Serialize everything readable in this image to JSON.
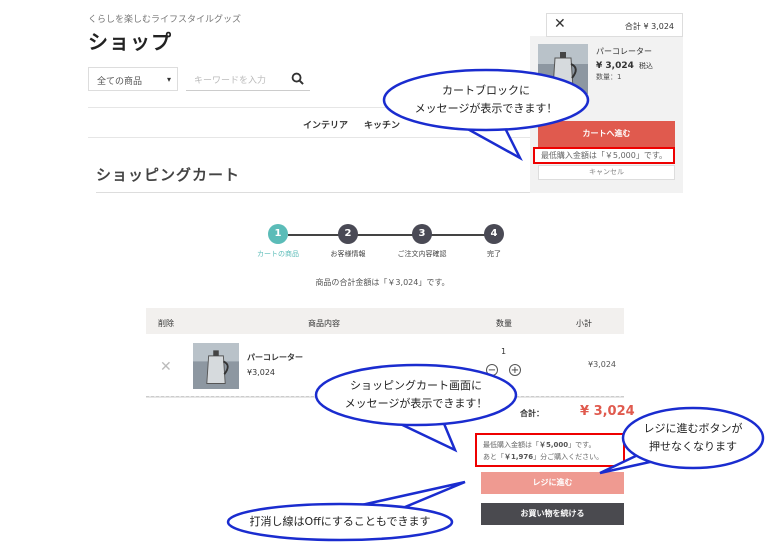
{
  "header": {
    "tagline": "くらしを楽しむライフスタイルグッズ",
    "title": "ショップ"
  },
  "search": {
    "category": "全ての商品",
    "placeholder": "キーワードを入力"
  },
  "nav": {
    "items": [
      "インテリア",
      "キッチン"
    ]
  },
  "cart_title": "ショッピングカート",
  "minicart": {
    "total": "合計 ¥ 3,024",
    "product_name": "パーコレーター",
    "product_price": "¥ 3,024",
    "tax_label": "税込",
    "quantity": "数量：1",
    "to_cart_label": "カートへ進む",
    "min_message": "最低購入金額は「￥5,000」です。",
    "cancel_label": "キャンセル"
  },
  "steps": [
    {
      "num": "1",
      "label": "カートの商品"
    },
    {
      "num": "2",
      "label": "お客様情報"
    },
    {
      "num": "3",
      "label": "ご注文内容確認"
    },
    {
      "num": "4",
      "label": "完了"
    }
  ],
  "summary": "商品の合計金額は「￥3,024」です。",
  "table": {
    "headers": [
      "削除",
      "商品内容",
      "数量",
      "小計"
    ],
    "row": {
      "name": "パーコレーター",
      "price": "¥3,024",
      "qty": "1",
      "subtotal": "¥3,024"
    }
  },
  "total": {
    "label": "合計：",
    "value": "¥ 3,024"
  },
  "cart_message": {
    "line1_pre": "最低購入金額は「",
    "line1_amount": "￥5,000",
    "line1_post": "」です。",
    "line2_pre": "あと「",
    "line2_amount": "￥1,976",
    "line2_post": "」分ご購入ください。"
  },
  "buttons": {
    "checkout": "レジに進む",
    "continue": "お買い物を続ける"
  },
  "callouts": {
    "c1_line1": "カートブロックに",
    "c1_line2": "メッセージが表示できます！",
    "c2_line1": "ショッピングカート画面に",
    "c2_line2": "メッセージが表示できます！",
    "c3_line1": "レジに進むボタンが",
    "c3_line2": "押せなくなります",
    "c4": "打消し線はOffにすることもできます"
  },
  "colors": {
    "accent": "#e05a4e",
    "step_active": "#5bbcb8",
    "step_inactive": "#4a4a55",
    "highlight": "#e00000",
    "callout_border": "#1a2ccf"
  }
}
